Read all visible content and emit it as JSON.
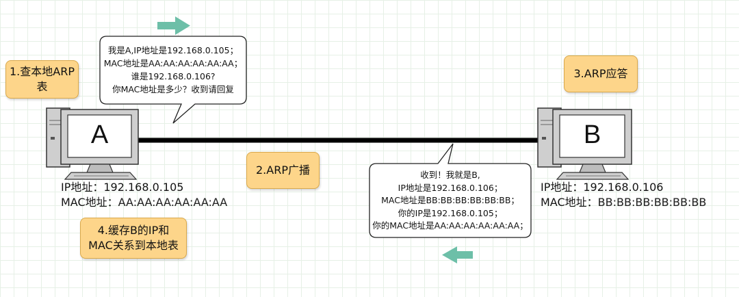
{
  "hostA": {
    "label": "A",
    "ip_label": "IP地址：",
    "ip_value": "192.168.0.105",
    "mac_label": "MAC地址：",
    "mac_value": "AA:AA:AA:AA:AA:AA"
  },
  "hostB": {
    "label": "B",
    "ip_label": "IP地址：",
    "ip_value": "192.168.0.106",
    "mac_label": "MAC地址：",
    "mac_value": "BB:BB:BB:BB:BB:BB"
  },
  "steps": {
    "step1_line1": "1.查本地ARP",
    "step1_line2": "表",
    "step2": "2.ARP广播",
    "step3": "3.ARP应答",
    "step4_line1": "4.缓存B的IP和",
    "step4_line2": "MAC关系到本地表"
  },
  "request_bubble": {
    "line1": "我是A,IP地址是192.168.0.105；",
    "line2": "MAC地址是AA:AA:AA:AA:AA:AA；",
    "line3": "谁是192.168.0.106?",
    "line4": "你MAC地址是多少？收到请回复"
  },
  "reply_bubble": {
    "line1": "收到！我就是B,",
    "line2": "IP地址是192.168.0.106；",
    "line3": "MAC地址是BB:BB:BB:BB:BB:BB；",
    "line4": "你的IP是192.168.0.105；",
    "line5": "你的MAC地址是AA:AA:AA:AA:AA:AA；"
  },
  "colors": {
    "arrow": "#6dbfa8",
    "note_fill": "#fdd58a",
    "computer_gray": "#c8c8c8"
  },
  "icons": {
    "arrow_right": "arrow-right-icon",
    "arrow_left": "arrow-left-icon",
    "computer": "computer-icon"
  }
}
